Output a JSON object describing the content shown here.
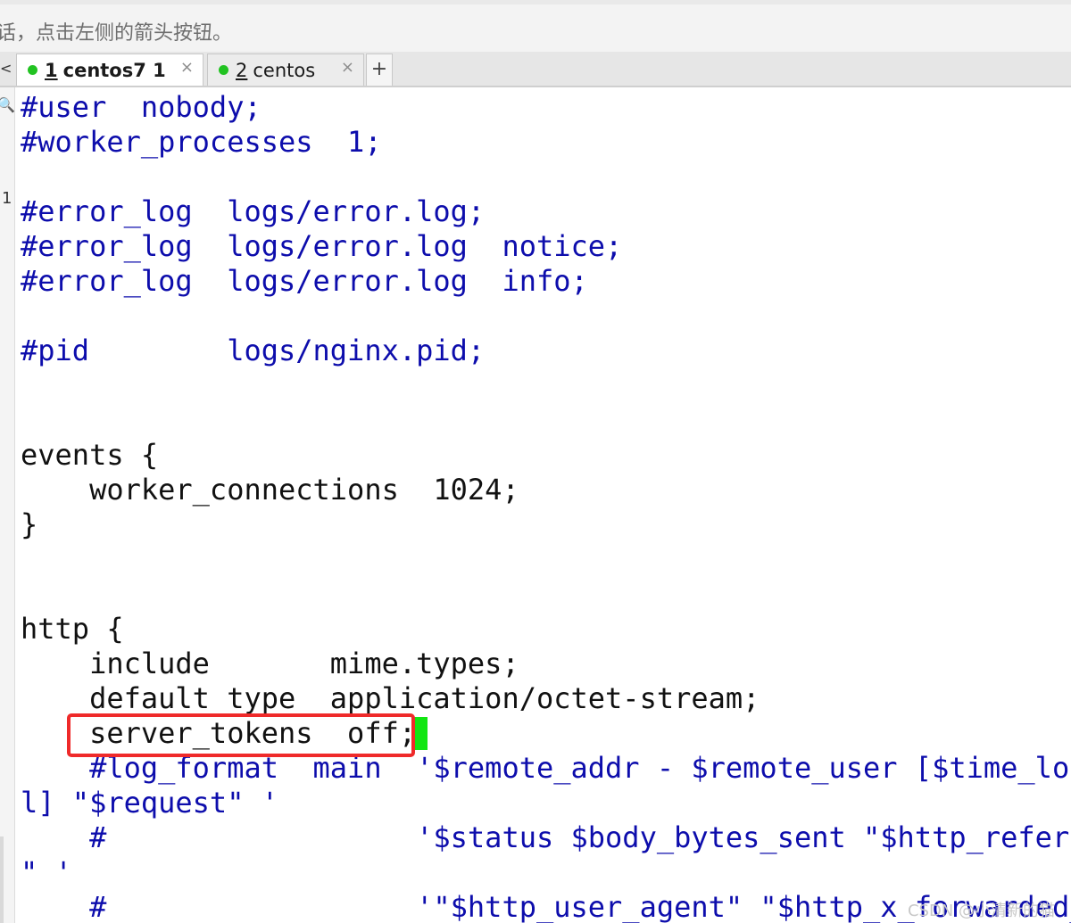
{
  "hint_bar": {
    "text": "话，点击左侧的箭头按钮。"
  },
  "tabs": [
    {
      "number": "1",
      "title": "centos7 1",
      "active": true,
      "close": "×"
    },
    {
      "number": "2",
      "title": "centos",
      "active": false,
      "close": "×"
    }
  ],
  "tab_edge_glyph": "<",
  "add_tab": "+",
  "gutter": {
    "mark": "1"
  },
  "terminal": {
    "lines": [
      "#user  nobody;",
      "#worker_processes  1;",
      "",
      "#error_log  logs/error.log;",
      "#error_log  logs/error.log  notice;",
      "#error_log  logs/error.log  info;",
      "",
      "#pid        logs/nginx.pid;",
      "",
      "",
      "events {",
      "    worker_connections  1024;",
      "}",
      "",
      "",
      "http {",
      "    include       mime.types;",
      "    default_type  application/octet-stream;",
      "    server_tokens  off;",
      "    #log_format  main  '$remote_addr - $remote_user [$time_loca",
      "l] \"$request\" '",
      "    #                  '$status $body_bytes_sent \"$http_referer",
      "\" '",
      "    #                  '\"$http_user_agent\" \"$http_x_forwarded_for"
    ],
    "line_colors": [
      "comment",
      "comment",
      "plain",
      "comment",
      "comment",
      "comment",
      "plain",
      "comment",
      "plain",
      "plain",
      "plain",
      "plain",
      "plain",
      "plain",
      "plain",
      "plain",
      "plain",
      "plain",
      "plain",
      "comment",
      "comment",
      "comment",
      "comment",
      "comment"
    ]
  },
  "watermark": "CSDN @小清新的猫",
  "colors": {
    "comment": "#0d0dac",
    "plain": "#111111",
    "highlight_box": "#ef2a2a",
    "cursor": "#12e612",
    "tab_status_dot": "#22c322"
  }
}
